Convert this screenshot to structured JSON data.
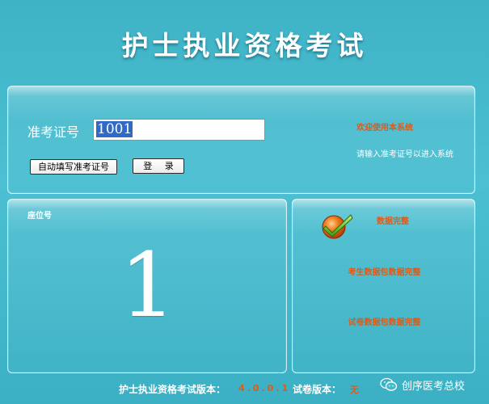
{
  "app": {
    "title": "护士执业资格考试"
  },
  "login": {
    "id_label": "准考证号",
    "id_value": "1001",
    "autofill_button": "自动填写准考证号",
    "login_button": "登 录",
    "welcome": "欢迎使用本系统",
    "hint": "请输入准考证号以进入系统"
  },
  "seat": {
    "label": "座位号",
    "number": "1"
  },
  "status": {
    "title": "数据完整",
    "candidate_data": "考生数据包数据完整",
    "paper_data": "试卷数据包数据完整"
  },
  "footer": {
    "version_label": "护士执业资格考试版本：",
    "version_value": "4.0.0.1",
    "paper_version_label": "试卷版本：",
    "paper_version_value": "无"
  },
  "watermark": {
    "text": "创序医考总校"
  },
  "colors": {
    "accent": "#e05a17",
    "background": "#46bacd",
    "selection": "#3169c6"
  },
  "icons": {
    "status": "check-icon",
    "watermark": "wechat-icon"
  }
}
